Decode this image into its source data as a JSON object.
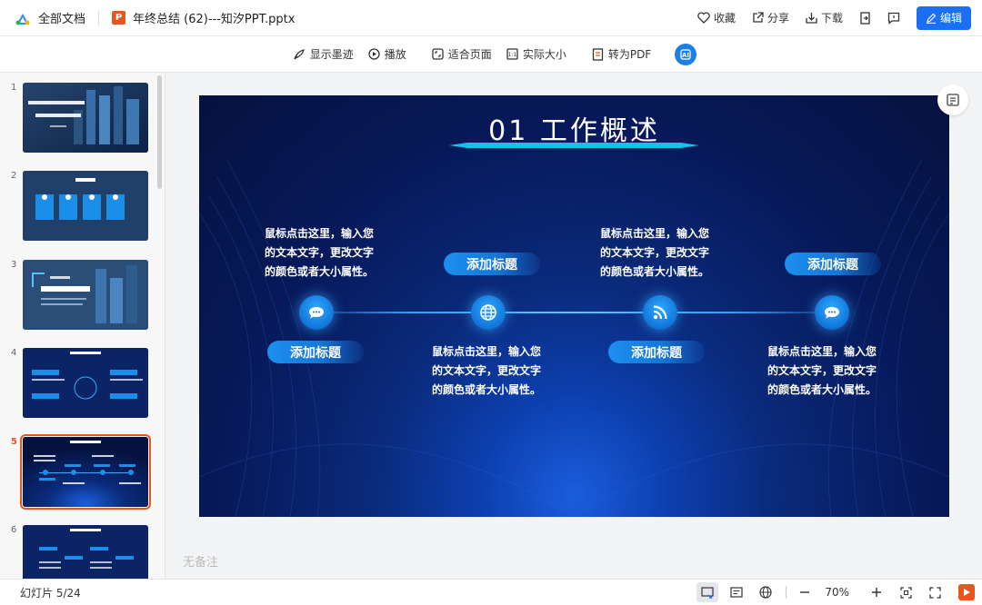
{
  "header": {
    "all_docs": "全部文档",
    "file_badge": "P",
    "filename": "年终总结 (62)---知汐PPT.pptx",
    "actions": {
      "favorite": "收藏",
      "share": "分享",
      "download": "下载"
    },
    "edit": "编辑",
    "accent": "#1b6ff5"
  },
  "toolbar": {
    "show_ink": "显示墨迹",
    "play": "播放",
    "fit_page": "适合页面",
    "actual_size": "实际大小",
    "to_pdf": "转为PDF",
    "ai_icon": "ai-assistant-icon"
  },
  "sidebar": {
    "slides": [
      {
        "num": "1",
        "theme": "cover"
      },
      {
        "num": "2",
        "theme": "contents"
      },
      {
        "num": "3",
        "theme": "section"
      },
      {
        "num": "4",
        "theme": "overview-a"
      },
      {
        "num": "5",
        "theme": "overview-b",
        "active": true
      },
      {
        "num": "6",
        "theme": "overview-c"
      }
    ]
  },
  "slide": {
    "title": "01 工作概述",
    "items": [
      {
        "heading": "添加标题",
        "text": [
          "鼠标点击这里，输入您",
          "的文本文字，更改文字",
          "的颜色或者大小属性。"
        ],
        "icon": "chat-bubble-icon"
      },
      {
        "heading": "添加标题",
        "text": [
          "鼠标点击这里，输入您",
          "的文本文字，更改文字",
          "的颜色或者大小属性。"
        ],
        "icon": "globe-icon"
      },
      {
        "heading": "添加标题",
        "text": [
          "鼠标点击这里，输入您",
          "的文本文字，更改文字",
          "的颜色或者大小属性。"
        ],
        "icon": "rss-icon"
      },
      {
        "heading": "添加标题",
        "text": [
          "鼠标点击这里，输入您",
          "的文本文字，更改文字",
          "的颜色或者大小属性。"
        ],
        "icon": "chat-bubble-icon"
      }
    ]
  },
  "notes": "无备注",
  "status": {
    "slide_count": "幻灯片 5/24",
    "zoom": "70%"
  },
  "colors": {
    "brand_orange": "#e8561e",
    "slide_blue": "#0a2a7a"
  }
}
